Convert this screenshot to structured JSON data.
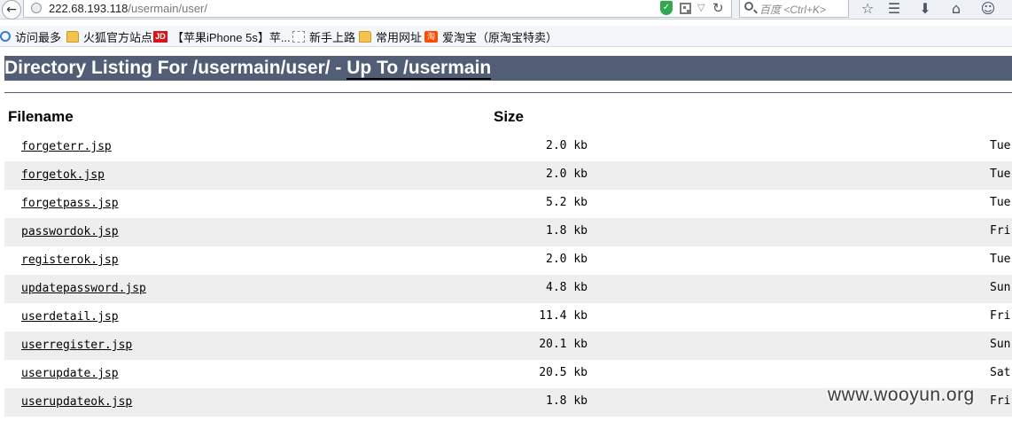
{
  "browser": {
    "url_host": "222.68.193.118",
    "url_path": "/usermain/user/",
    "search_placeholder": "百度 <Ctrl+K>"
  },
  "bookmarks": [
    {
      "label": "访问最多",
      "icon": "gear-icon"
    },
    {
      "label": "火狐官方站点",
      "icon": "folder-icon"
    },
    {
      "label": "【苹果iPhone 5s】苹...",
      "icon": "jd-icon",
      "icon_text": "JD"
    },
    {
      "label": "新手上路",
      "icon": "page-icon"
    },
    {
      "label": "常用网址",
      "icon": "folder-icon"
    },
    {
      "label": "爱淘宝（原淘宝特卖）",
      "icon": "taobao-icon",
      "icon_text": "淘"
    }
  ],
  "page": {
    "heading_prefix": "Directory Listing For /usermain/user/ - ",
    "heading_link": "Up To /usermain",
    "columns": {
      "filename": "Filename",
      "size": "Size"
    },
    "files": [
      {
        "name": "forgeterr.jsp",
        "size": "2.0 kb",
        "date": "Tue"
      },
      {
        "name": "forgetok.jsp",
        "size": "2.0 kb",
        "date": "Tue"
      },
      {
        "name": "forgetpass.jsp",
        "size": "5.2 kb",
        "date": "Tue"
      },
      {
        "name": "passwordok.jsp",
        "size": "1.8 kb",
        "date": "Fri"
      },
      {
        "name": "registerok.jsp",
        "size": "2.0 kb",
        "date": "Tue"
      },
      {
        "name": "updatepassword.jsp",
        "size": "4.8 kb",
        "date": "Sun"
      },
      {
        "name": "userdetail.jsp",
        "size": "11.4 kb",
        "date": "Fri"
      },
      {
        "name": "userregister.jsp",
        "size": "20.1 kb",
        "date": "Sun"
      },
      {
        "name": "userupdate.jsp",
        "size": "20.5 kb",
        "date": "Sat"
      },
      {
        "name": "userupdateok.jsp",
        "size": "1.8 kb",
        "date": "Fri"
      }
    ]
  },
  "watermark": "www.wooyun.org",
  "colors": {
    "heading_bg": "#525d76",
    "row_alt": "#eeeeee"
  }
}
